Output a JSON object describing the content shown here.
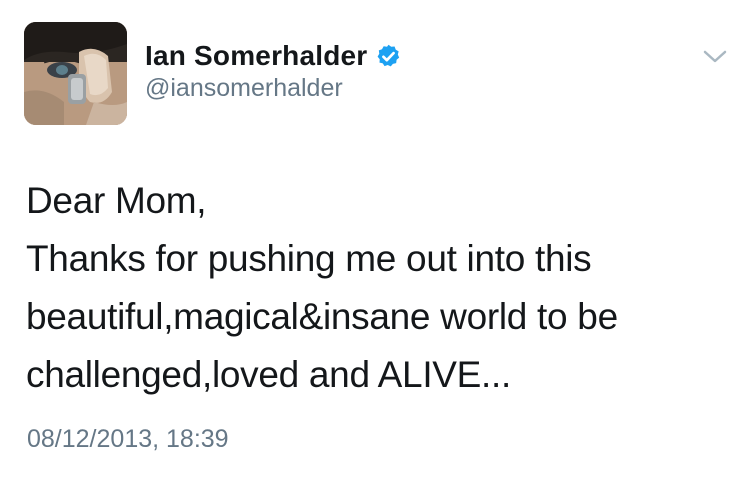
{
  "author": {
    "display_name": "Ian Somerhalder",
    "handle": "@iansomerhalder",
    "avatar_icon": "profile-photo",
    "verified_icon": "verified-badge-icon"
  },
  "menu": {
    "caret_icon": "chevron-down-icon"
  },
  "tweet": {
    "lines": [
      "Dear Mom,",
      "Thanks for pushing me out into this",
      "beautiful,magical&insane world to be",
      "challenged,loved and ALIVE..."
    ],
    "timestamp": "08/12/2013, 18:39"
  },
  "colors": {
    "text": "#14171a",
    "secondary_text": "#657786",
    "verified_blue": "#1da1f2",
    "background": "#ffffff"
  }
}
